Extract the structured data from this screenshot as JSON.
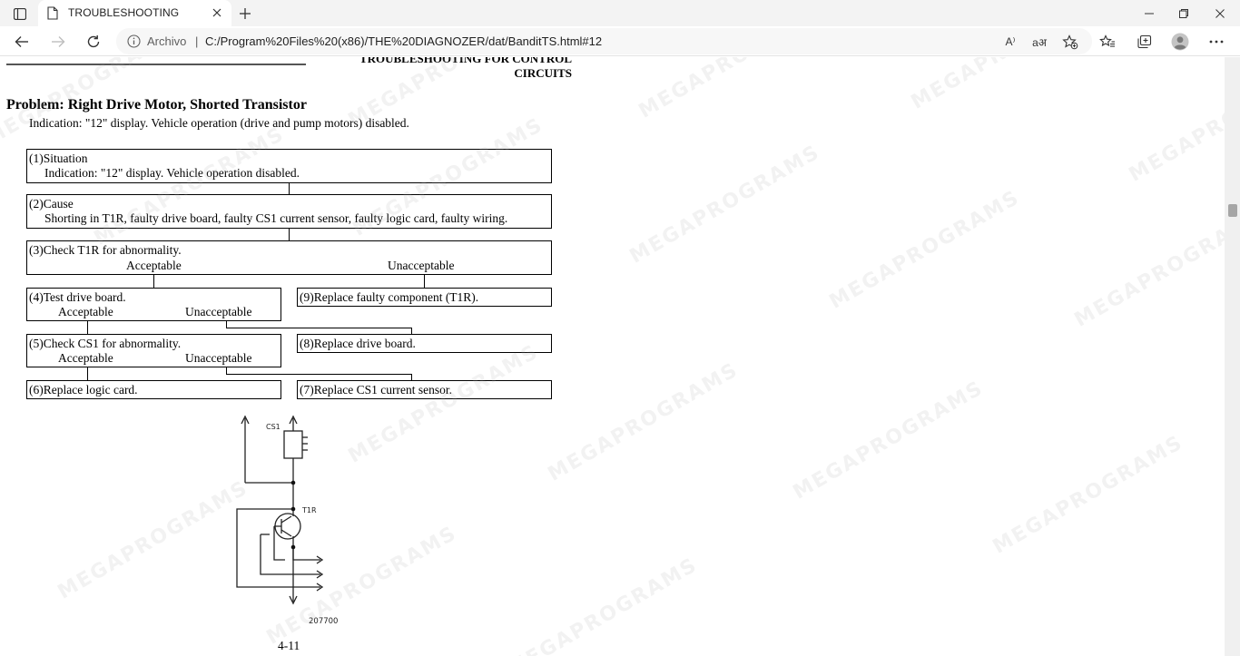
{
  "tab": {
    "title": "TROUBLESHOOTING",
    "close_glyph": "✕"
  },
  "toolbar": {
    "new_tab_glyph": "+"
  },
  "address": {
    "label": "Archivo",
    "separator": "|",
    "url": "C:/Program%20Files%20(x86)/THE%20DIAGNOZER/dat/BanditTS.html#12",
    "read_aloud_text": "A⁾",
    "translate_text": "aअ"
  },
  "doc": {
    "header_line1": "TROUBLESHOOTING FOR CONTROL",
    "header_line2": "CIRCUITS",
    "problem_title": "Problem: Right Drive Motor, Shorted Transistor",
    "indication": "Indication: \"12\" display. Vehicle operation (drive and pump motors) disabled."
  },
  "flow": {
    "step1_title": "(1)Situation",
    "step1_detail": "Indication: \"12\" display. Vehicle operation disabled.",
    "step2_title": "(2)Cause",
    "step2_detail": "Shorting in T1R, faulty drive board, faulty CS1 current sensor, faulty logic card, faulty wiring.",
    "step3_title": "(3)Check T1R for abnormality.",
    "step3_acceptable": "Acceptable",
    "step3_unacceptable": "Unacceptable",
    "step4_title": "(4)Test drive board.",
    "step4_acceptable": "Acceptable",
    "step4_unacceptable": "Unacceptable",
    "step5_title": "(5)Check CS1 for abnormality.",
    "step5_acceptable": "Acceptable",
    "step5_unacceptable": "Unacceptable",
    "step6_title": "(6)Replace logic card.",
    "step7_title": "(7)Replace CS1 current sensor.",
    "step8_title": "(8)Replace drive board.",
    "step9_title": "(9)Replace faulty component (T1R)."
  },
  "circuit": {
    "cs1_label": "CS1",
    "t1r_label": "T1R",
    "figure_id": "207700"
  },
  "page_number": "4-11",
  "watermark_text": "MEGAPROGRAMS",
  "colors": {
    "tabstrip_bg": "#f3f3f3",
    "addressbar_bg": "#f7f7f7",
    "text": "#000000",
    "icon": "#333333"
  }
}
